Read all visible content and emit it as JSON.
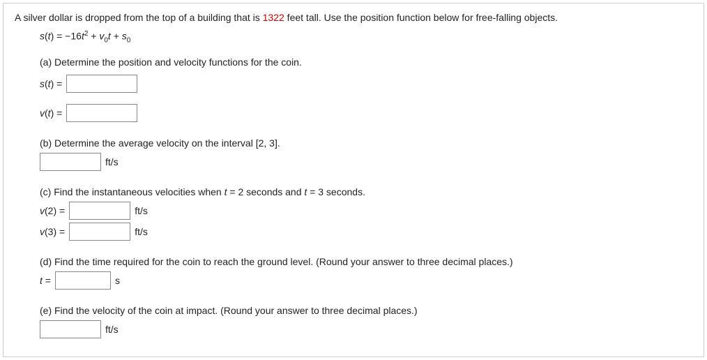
{
  "problem": {
    "intro_prefix": "A silver dollar is dropped from the top of a building that is ",
    "height_value": "1322",
    "intro_suffix": " feet tall. Use the position function below for free-falling objects.",
    "equation": "s(t) = −16t² + v₀t + s₀"
  },
  "part_a": {
    "label": "(a) Determine the position and velocity functions for the coin.",
    "s_label": "s(t) =",
    "v_label": "v(t) ="
  },
  "part_b": {
    "label": "(b) Determine the average velocity on the interval [2, 3].",
    "unit": "ft/s"
  },
  "part_c": {
    "label": "(c) Find the instantaneous velocities when t = 2 seconds and t = 3 seconds.",
    "v2_label": "v(2) =",
    "v3_label": "v(3) =",
    "unit": "ft/s"
  },
  "part_d": {
    "label": "(d) Find the time required for the coin to reach the ground level. (Round your answer to three decimal places.)",
    "t_label": "t =",
    "unit": "s"
  },
  "part_e": {
    "label": "(e) Find the velocity of the coin at impact. (Round your answer to three decimal places.)",
    "unit": "ft/s"
  }
}
